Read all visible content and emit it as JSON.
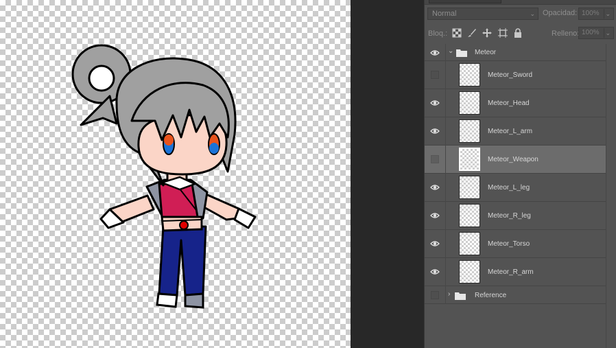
{
  "layers_panel": {
    "blend_mode": "Normal",
    "opacity_label": "Opacidad:",
    "opacity_value": "100%",
    "lock_label": "Bloq.:",
    "fill_label": "Relleno:",
    "fill_value": "100%",
    "lock_icons": [
      "lock-transparent-pixels-icon",
      "lock-image-pixels-icon",
      "lock-position-icon",
      "lock-artboard-icon",
      "lock-all-icon"
    ],
    "group": {
      "name": "Meteor",
      "visible": true,
      "expanded": true
    },
    "layers": [
      {
        "name": "Meteor_Sword",
        "visible": false,
        "selected": false
      },
      {
        "name": "Meteor_Head",
        "visible": true,
        "selected": false
      },
      {
        "name": "Meteor_L_arm",
        "visible": true,
        "selected": false
      },
      {
        "name": "Meteor_Weapon",
        "visible": false,
        "selected": true
      },
      {
        "name": "Meteor_L_leg",
        "visible": true,
        "selected": false
      },
      {
        "name": "Meteor_R_leg",
        "visible": true,
        "selected": false
      },
      {
        "name": "Meteor_Torso",
        "visible": true,
        "selected": false
      },
      {
        "name": "Meteor_R_arm",
        "visible": true,
        "selected": false
      }
    ],
    "reference_group": {
      "name": "Reference",
      "visible": false,
      "expanded": false
    }
  },
  "colors": {
    "hair": "#a0a0a0",
    "skin": "#fbd5c7",
    "shirt": "#d01e55",
    "jacket": "#8e94a3",
    "pants": "#16238a",
    "eye_left": "#e8531c",
    "eye_right": "#1a73d8"
  }
}
